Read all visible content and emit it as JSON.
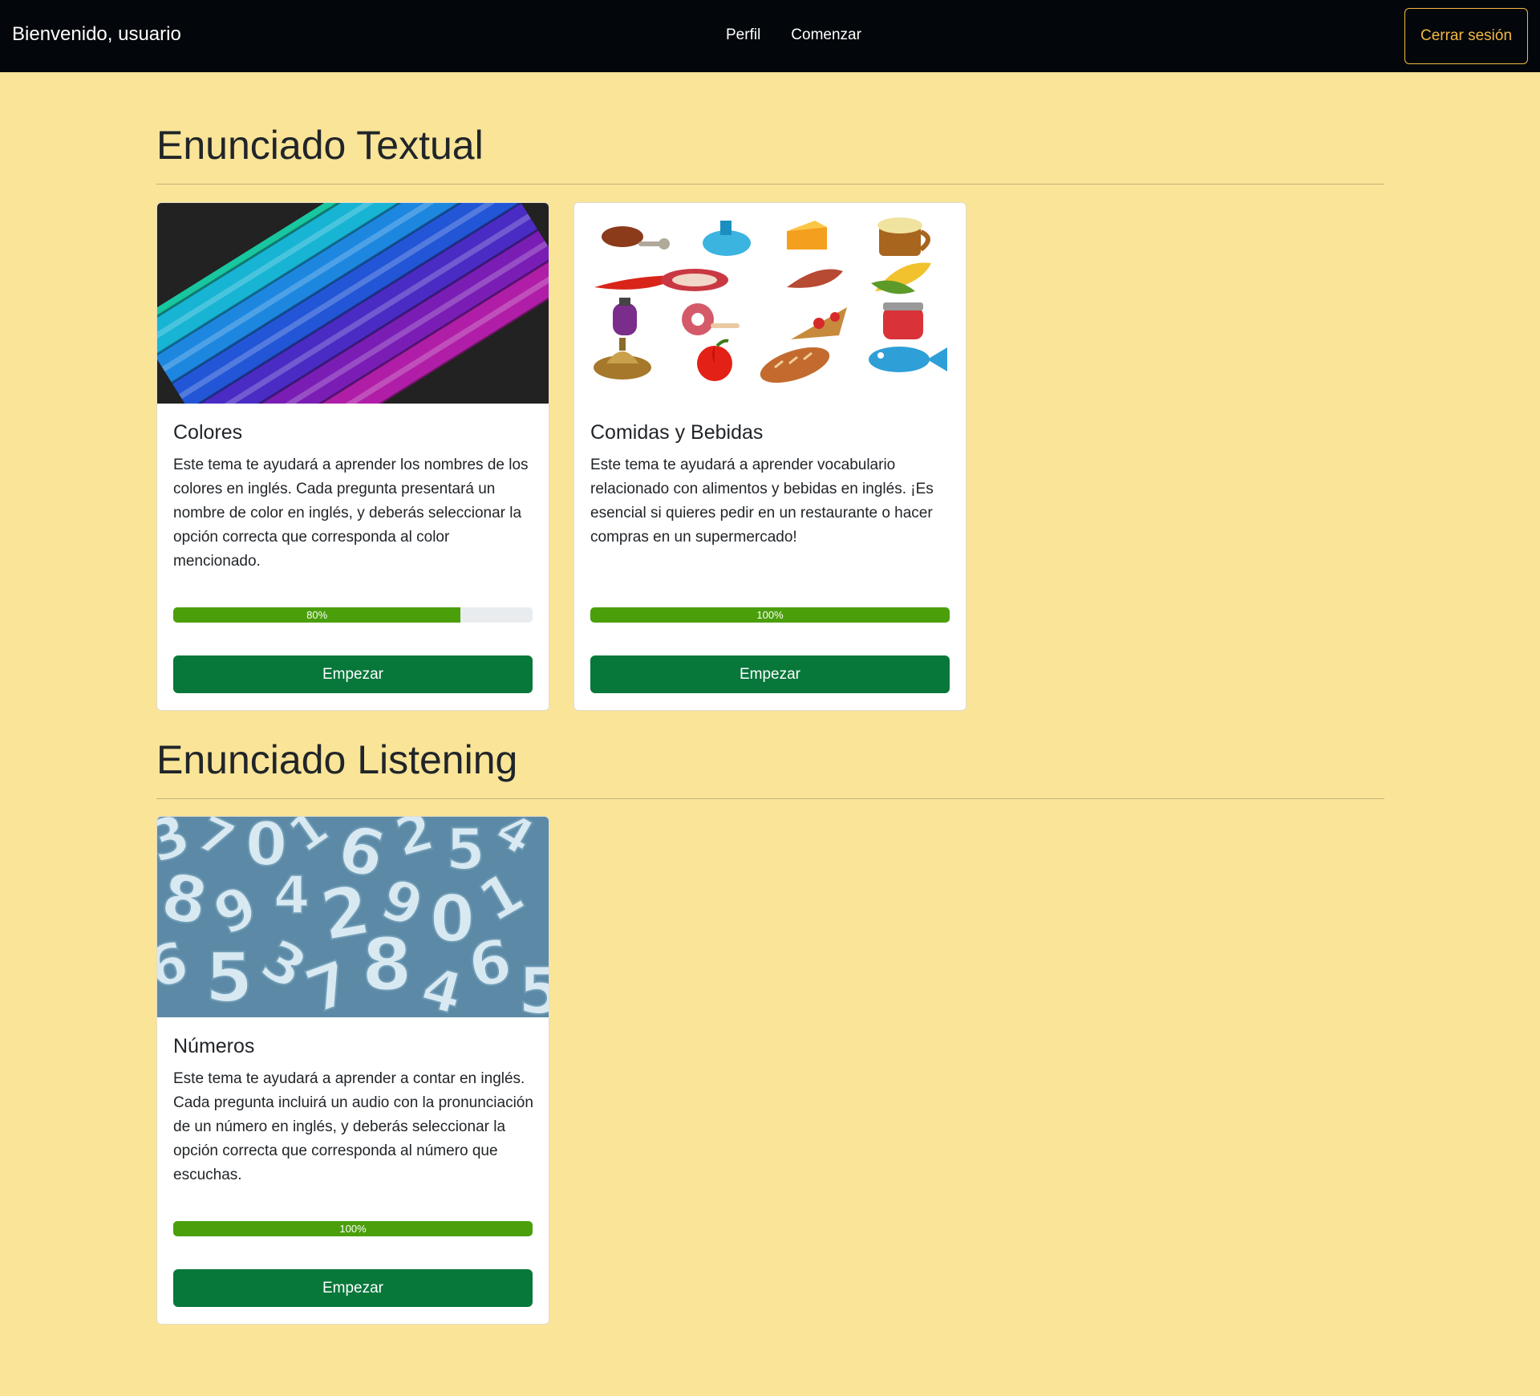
{
  "navbar": {
    "brand": "Bienvenido, usuario",
    "links": [
      "Perfil",
      "Comenzar"
    ],
    "logout_label": "Cerrar sesión",
    "colors": {
      "background": "#03070b",
      "logout_accent": "#f4b942"
    }
  },
  "sections": [
    {
      "title": "Enunciado Textual",
      "cards": [
        {
          "image": "colored-pencils-image",
          "title": "Colores",
          "text": "Este tema te ayudará a aprender los nombres de los colores en inglés. Cada pregunta presentará un nombre de color en inglés, y deberás seleccionar la opción correcta que corresponda al color mencionado.",
          "progress": 80,
          "progress_label": "80%",
          "button_label": "Empezar"
        },
        {
          "image": "food-and-drinks-image",
          "title": "Comidas y Bebidas",
          "text": "Este tema te ayudará a aprender vocabulario relacionado con alimentos y bebidas en inglés. ¡Es esencial si quieres pedir en un restaurante o hacer compras en un supermercado!",
          "progress": 100,
          "progress_label": "100%",
          "button_label": "Empezar"
        }
      ]
    },
    {
      "title": "Enunciado Listening",
      "cards": [
        {
          "image": "numbers-image",
          "title": "Números",
          "text": "Este tema te ayudará a aprender a contar en inglés. Cada pregunta incluirá un audio con la pronunciación de un número en inglés, y deberás seleccionar la opción correcta que corresponda al número que escuchas.",
          "progress": 100,
          "progress_label": "100%",
          "button_label": "Empezar"
        }
      ]
    }
  ],
  "colors": {
    "page_background": "#f9e498",
    "progress_fill": "#4a9f0b",
    "button": "#08773a"
  }
}
